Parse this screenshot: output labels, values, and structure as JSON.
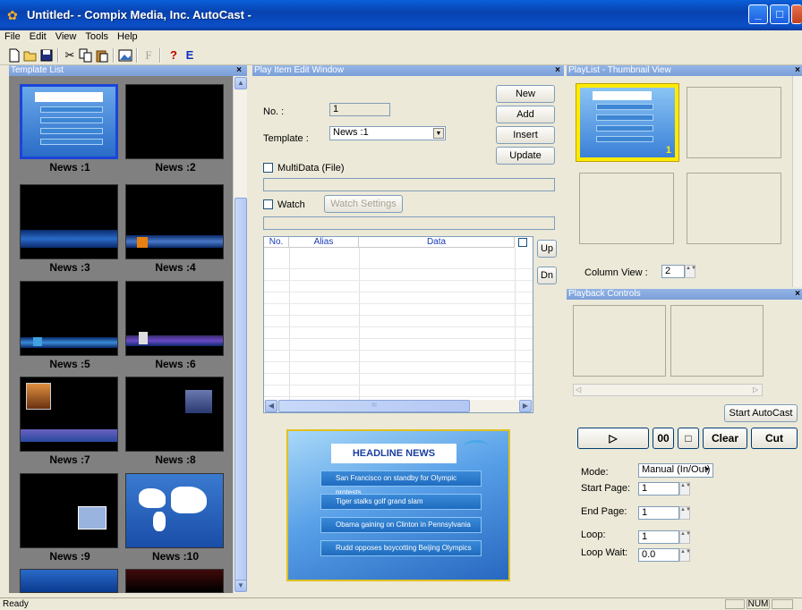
{
  "window": {
    "title": "Untitled- - Compix Media, Inc. AutoCast -",
    "min_label": "_",
    "max_label": "□",
    "close_label": "X"
  },
  "menu": [
    "File",
    "Edit",
    "View",
    "Tools",
    "Help"
  ],
  "toolbar": {
    "icons": [
      "new-icon",
      "open-icon",
      "save-icon",
      "cut-icon",
      "copy-icon",
      "paste-icon",
      "image-icon",
      "font-icon",
      "help-icon",
      "e-icon"
    ],
    "font_label": "F",
    "help_label": "?",
    "e_label": "E"
  },
  "template_list": {
    "header": "Template List",
    "close": "×",
    "items": [
      "News :1",
      "News :2",
      "News :3",
      "News :4",
      "News :5",
      "News :6",
      "News :7",
      "News :8",
      "News :9",
      "News :10"
    ]
  },
  "edit_window": {
    "header": "Play Item Edit Window",
    "close": "×",
    "no_label": "No. :",
    "no_value": "1",
    "template_label": "Template :",
    "template_value": "News :1",
    "multidata_label": "MultiData (File)",
    "watch_label": "Watch",
    "watch_settings": "Watch Settings",
    "buttons": {
      "new": "New",
      "add": "Add",
      "insert": "Insert",
      "update": "Update"
    },
    "grid_headers": [
      "No.",
      "Alias",
      "Data"
    ],
    "up": "Up",
    "dn": "Dn",
    "scroll_mid": "III"
  },
  "preview": {
    "headline": "HEADLINE NEWS",
    "items": [
      "San Francisco on standby for Olympic protests",
      "Tiger stalks golf grand slam",
      "Obama gaining on Clinton in Pennsylvania",
      "Rudd opposes boycotting Beijing Olympics"
    ]
  },
  "playlist": {
    "header": "PlayList - Thumbnail View",
    "close": "×",
    "thumb_number": "1",
    "column_view_label": "Column View :",
    "column_view_value": "2"
  },
  "playback": {
    "header": "Playback Controls",
    "close": "×",
    "start_autocast": "Start AutoCast",
    "play": "▷",
    "pause": "00",
    "stop": "□",
    "clear": "Clear",
    "cut": "Cut",
    "mode_label": "Mode:",
    "mode_value": "Manual (In/Out)",
    "start_page_label": "Start Page:",
    "start_page_value": "1",
    "end_page_label": "End Page:",
    "end_page_value": "1",
    "loop_label": "Loop:",
    "loop_value": "1",
    "loop_wait_label": "Loop Wait:",
    "loop_wait_value": "0.0"
  },
  "status": {
    "text": "Ready",
    "num": "NUM"
  },
  "colors": {
    "titlebar": "#0842b0",
    "panel_header": "#7a9fd8",
    "selection": "#1c44d8",
    "playlist_selection": "#ffeb00",
    "news_blue": "#1f6cc0"
  }
}
